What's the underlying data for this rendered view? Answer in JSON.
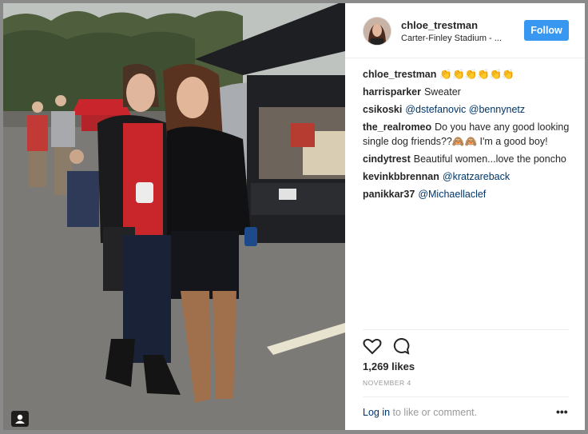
{
  "post": {
    "username": "chloe_trestman",
    "location": "Carter-Finley Stadium - ...",
    "follow_label": "Follow",
    "caption_user": "chloe_trestman",
    "caption_text": "👏👏👏👏👏👏",
    "likes": "1,269 likes",
    "date": "NOVEMBER 4",
    "login_link": "Log in",
    "login_rest": " to like or comment.",
    "more": "•••"
  },
  "comments": [
    {
      "user": "harrisparker",
      "text": "Sweater"
    },
    {
      "user": "csikoski",
      "mentions": [
        "@dstefanovic",
        "@bennynetz"
      ]
    },
    {
      "user": "the_realromeo",
      "text": "Do you have any good looking single dog friends??🙈🙈 I'm a good boy!"
    },
    {
      "user": "cindytrest",
      "text": "Beautiful women...love the poncho"
    },
    {
      "user": "kevinkbbrennan",
      "mentions": [
        "@kratzareback"
      ]
    },
    {
      "user": "panikkar37",
      "mentions": [
        "@Michaellaclef"
      ]
    }
  ],
  "icons": [
    "heart-icon",
    "comment-icon",
    "user-tag-icon",
    "more-options-icon"
  ],
  "colors": {
    "follow": "#3897f0",
    "mention": "#003569",
    "text": "#262626",
    "muted": "#999999"
  }
}
